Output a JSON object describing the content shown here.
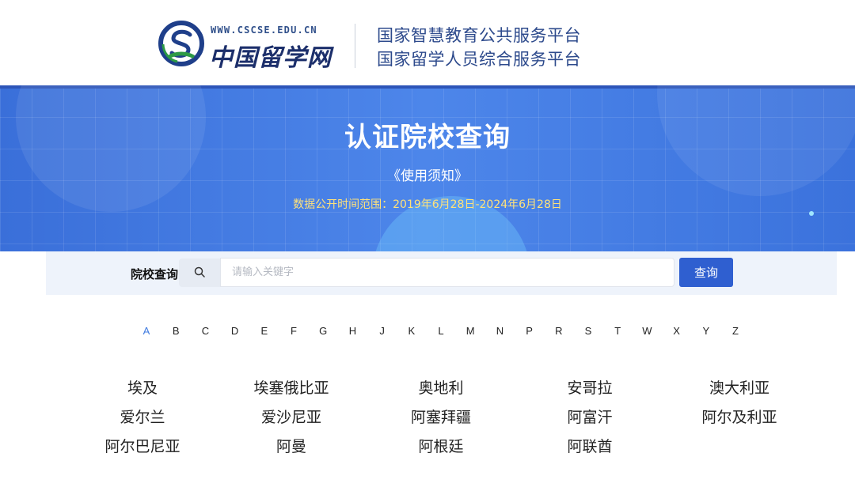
{
  "header": {
    "logo_url": "WWW.CSCSE.EDU.CN",
    "logo_name": "中国留学网",
    "platforms": [
      "国家智慧教育公共服务平台",
      "国家留学人员综合服务平台"
    ]
  },
  "banner": {
    "title": "认证院校查询",
    "notice_link": "《使用须知》",
    "data_range": "数据公开时间范围：2019年6月28日-2024年6月28日"
  },
  "search": {
    "label": "院校查询",
    "placeholder": "请输入关键字",
    "value": "",
    "button_label": "查询"
  },
  "alphabet": {
    "letters": [
      "A",
      "B",
      "C",
      "D",
      "E",
      "F",
      "G",
      "H",
      "J",
      "K",
      "L",
      "M",
      "N",
      "P",
      "R",
      "S",
      "T",
      "W",
      "X",
      "Y",
      "Z"
    ],
    "selected": "A"
  },
  "countries": [
    [
      "埃及",
      "埃塞俄比亚",
      "奥地利",
      "安哥拉",
      "澳大利亚"
    ],
    [
      "爱尔兰",
      "爱沙尼亚",
      "阿塞拜疆",
      "阿富汗",
      "阿尔及利亚"
    ],
    [
      "阿尔巴尼亚",
      "阿曼",
      "阿根廷",
      "阿联酋"
    ]
  ],
  "colors": {
    "brand_blue": "#2f5fd0",
    "banner_blue": "#4d86ea",
    "active_letter": "#3f7be0",
    "range_text": "#ffe27a",
    "header_text": "#2d4a8c"
  },
  "icons": {
    "logo": "cscse-logo-icon",
    "search": "search-icon"
  }
}
